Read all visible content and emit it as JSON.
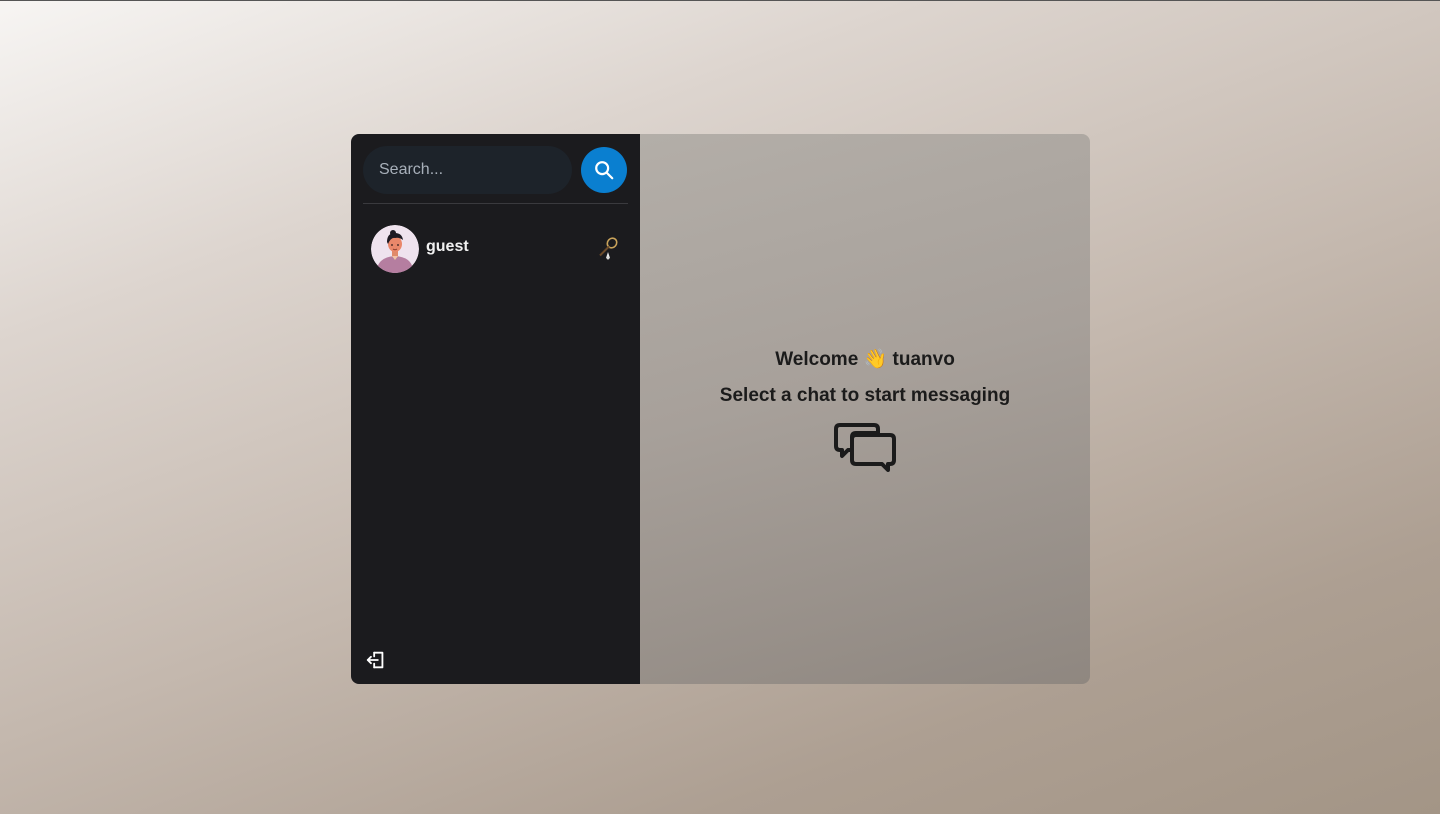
{
  "sidebar": {
    "search": {
      "placeholder": "Search...",
      "value": ""
    },
    "search_button_icon": "search-icon",
    "conversations": [
      {
        "name": "guest",
        "avatar_icon": "user-avatar",
        "emoji": "🏸"
      }
    ],
    "logout_icon": "logout-icon"
  },
  "main": {
    "welcome_prefix": "Welcome",
    "welcome_emoji": "👋",
    "username": "tuanvo",
    "subtitle": "Select a chat to start messaging",
    "icon": "chat-bubbles-icon"
  },
  "colors": {
    "sidebar_bg": "#1b1b1e",
    "search_button": "#0a7fd0",
    "main_text": "#1b1b1b"
  }
}
